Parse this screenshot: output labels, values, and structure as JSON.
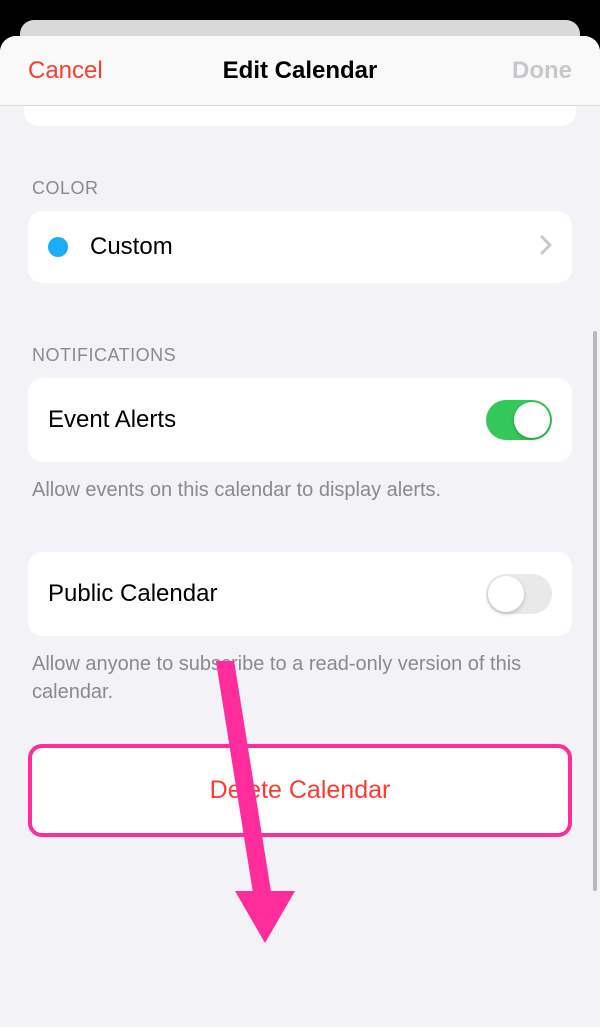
{
  "header": {
    "cancel_label": "Cancel",
    "title": "Edit Calendar",
    "done_label": "Done"
  },
  "color_section": {
    "header": "COLOR",
    "label": "Custom",
    "swatch_hex": "#1badf8"
  },
  "notifications_section": {
    "header": "NOTIFICATIONS",
    "event_alerts": {
      "label": "Event Alerts",
      "enabled": true
    },
    "footer": "Allow events on this calendar to display alerts."
  },
  "public_section": {
    "label": "Public Calendar",
    "enabled": false,
    "footer": "Allow anyone to subscribe to a read-only version of this calendar."
  },
  "delete_section": {
    "label": "Delete Calendar"
  },
  "annotation": {
    "highlight_color": "#ff2d9b"
  }
}
